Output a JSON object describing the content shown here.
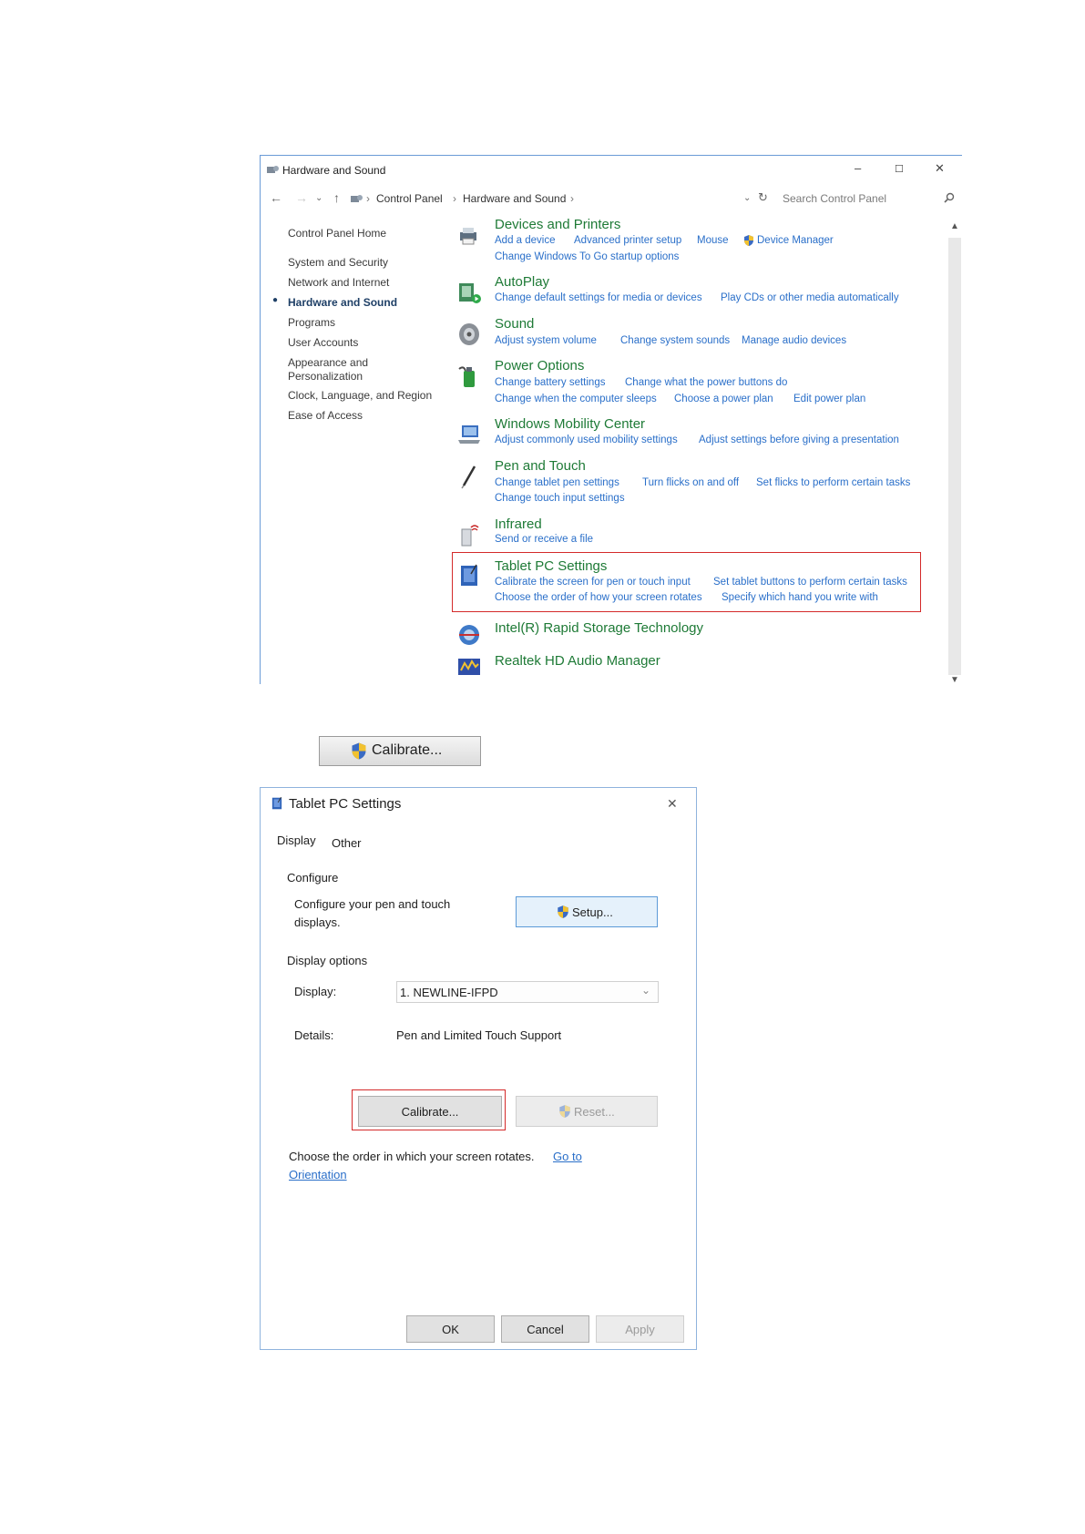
{
  "control_panel": {
    "window_title": "Hardware and Sound",
    "window_controls": [
      "–",
      "☐",
      "✕"
    ],
    "breadcrumb": [
      "Control Panel",
      "Hardware and Sound"
    ],
    "search_placeholder": "Search Control Panel",
    "sidebar": [
      {
        "label": "Control Panel Home",
        "active": false
      },
      {
        "label": "System and Security",
        "active": false
      },
      {
        "label": "Network and Internet",
        "active": false
      },
      {
        "label": "Hardware and Sound",
        "active": true
      },
      {
        "label": "Programs",
        "active": false
      },
      {
        "label": "User Accounts",
        "active": false
      },
      {
        "label": "Appearance and",
        "active": false
      },
      {
        "label": "Personalization",
        "active": false
      },
      {
        "label": "Clock, Language, and Region",
        "active": false
      },
      {
        "label": "Ease of Access",
        "active": false
      }
    ],
    "categories": [
      {
        "title": "Devices and Printers",
        "icon": "printer-icon",
        "links": [
          [
            "Add a device",
            "Advanced printer setup",
            "Mouse",
            "Device Manager"
          ],
          [
            "Change Windows To Go startup options"
          ]
        ]
      },
      {
        "title": "AutoPlay",
        "icon": "autoplay-icon",
        "links": [
          [
            "Change default settings for media or devices",
            "Play CDs or other media automatically"
          ]
        ]
      },
      {
        "title": "Sound",
        "icon": "speaker-icon",
        "links": [
          [
            "Adjust system volume",
            "Change system sounds",
            "Manage audio devices"
          ]
        ]
      },
      {
        "title": "Power Options",
        "icon": "power-icon",
        "links": [
          [
            "Change battery settings",
            "Change what the power buttons do"
          ],
          [
            "Change when the computer sleeps",
            "Choose a power plan",
            "Edit power plan"
          ]
        ]
      },
      {
        "title": "Windows Mobility Center",
        "icon": "laptop-icon",
        "links": [
          [
            "Adjust commonly used mobility settings",
            "Adjust settings before giving a presentation"
          ]
        ]
      },
      {
        "title": "Pen and Touch",
        "icon": "pen-icon",
        "links": [
          [
            "Change tablet pen settings",
            "Turn flicks on and off",
            "Set flicks to perform certain tasks"
          ],
          [
            "Change touch input settings"
          ]
        ]
      },
      {
        "title": "Infrared",
        "icon": "infrared-icon",
        "links": [
          [
            "Send or receive a file"
          ]
        ]
      },
      {
        "title": "Tablet PC Settings",
        "icon": "tablet-icon",
        "links": [
          [
            "Calibrate the screen for pen or touch input",
            "Set tablet buttons to perform certain tasks"
          ],
          [
            "Choose the order of how your screen rotates",
            "Specify which hand you write with"
          ]
        ]
      },
      {
        "title": "Intel(R) Rapid Storage Technology",
        "icon": "storage-icon",
        "links": []
      },
      {
        "title": "Realtek HD Audio Manager",
        "icon": "audio-manager-icon",
        "links": []
      }
    ]
  },
  "calibrate_button_large": {
    "label": "Calibrate..."
  },
  "tablet_dialog": {
    "title": "Tablet PC Settings",
    "close": "✕",
    "tabs": [
      "Display",
      "Other"
    ],
    "configure_heading": "Configure",
    "configure_text_1": "Configure your pen and touch",
    "configure_text_2": "displays.",
    "setup_label": "Setup...",
    "display_options_heading": "Display options",
    "display_label": "Display:",
    "display_value": "1. NEWLINE-IFPD",
    "details_label": "Details:",
    "details_value": "Pen and Limited Touch Support",
    "calibrate_label": "Calibrate...",
    "reset_label": "Reset...",
    "orientation_text": "Choose the order in which your screen rotates.",
    "orientation_link_1": "Go to",
    "orientation_link_2": "Orientation",
    "ok_label": "OK",
    "cancel_label": "Cancel",
    "apply_label": "Apply"
  }
}
